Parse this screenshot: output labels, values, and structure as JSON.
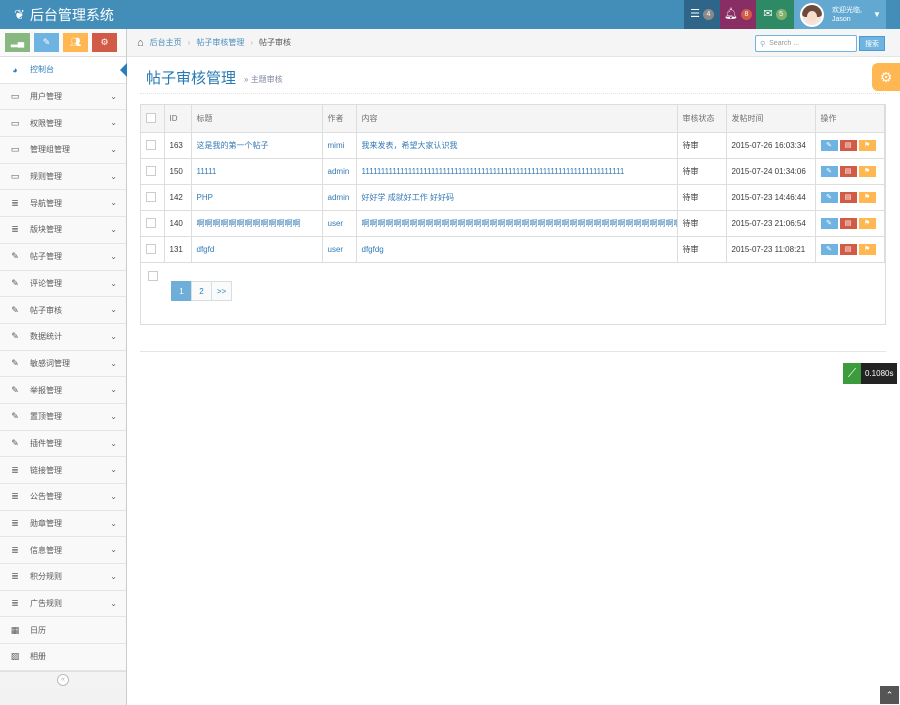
{
  "app": {
    "brand": "后台管理系统",
    "brand_icon": "leaf-icon"
  },
  "navbar": {
    "tasks_badge": "4",
    "notifications_badge": "8",
    "messages_badge": "5",
    "user_greeting": "欢迎光临,",
    "user_name": "Jason"
  },
  "shortcuts": [
    {
      "icon": "signal-icon",
      "color": "#87b87f"
    },
    {
      "icon": "pencil-icon",
      "color": "#6fb3e0"
    },
    {
      "icon": "group-icon",
      "color": "#ffb752"
    },
    {
      "icon": "cogs-icon",
      "color": "#d15b47"
    }
  ],
  "sidebar": {
    "items": [
      {
        "label": "控制台",
        "icon": "dashboard-icon",
        "has_children": false,
        "active": true
      },
      {
        "label": "用户管理",
        "icon": "desktop-icon",
        "has_children": true
      },
      {
        "label": "权限管理",
        "icon": "desktop-icon",
        "has_children": true
      },
      {
        "label": "管理组管理",
        "icon": "desktop-icon",
        "has_children": true
      },
      {
        "label": "规则管理",
        "icon": "desktop-icon",
        "has_children": true
      },
      {
        "label": "导航管理",
        "icon": "list-icon",
        "has_children": true
      },
      {
        "label": "版块管理",
        "icon": "list-icon",
        "has_children": true
      },
      {
        "label": "帖子管理",
        "icon": "edit-icon",
        "has_children": true
      },
      {
        "label": "评论管理",
        "icon": "edit-icon",
        "has_children": true
      },
      {
        "label": "帖子审核",
        "icon": "edit-icon",
        "has_children": true
      },
      {
        "label": "数据统计",
        "icon": "edit-icon",
        "has_children": true
      },
      {
        "label": "敏感词管理",
        "icon": "edit-icon",
        "has_children": true
      },
      {
        "label": "举报管理",
        "icon": "edit-icon",
        "has_children": true
      },
      {
        "label": "置顶管理",
        "icon": "edit-icon",
        "has_children": true
      },
      {
        "label": "插件管理",
        "icon": "edit-icon",
        "has_children": true
      },
      {
        "label": "链接管理",
        "icon": "list-icon",
        "has_children": true
      },
      {
        "label": "公告管理",
        "icon": "list-icon",
        "has_children": true
      },
      {
        "label": "勋章管理",
        "icon": "list-icon",
        "has_children": true
      },
      {
        "label": "信息管理",
        "icon": "list-icon",
        "has_children": true
      },
      {
        "label": "积分规则",
        "icon": "list-icon",
        "has_children": true
      },
      {
        "label": "广告规则",
        "icon": "list-icon",
        "has_children": true
      },
      {
        "label": "日历",
        "icon": "calendar-icon",
        "has_children": false
      },
      {
        "label": "相册",
        "icon": "picture-icon",
        "has_children": false
      }
    ]
  },
  "breadcrumb": {
    "home": "后台主页",
    "section": "帖子审核管理",
    "current": "帖子审核"
  },
  "search": {
    "placeholder": "Search ...",
    "button": "搜索"
  },
  "page": {
    "title": "帖子审核管理",
    "subtitle": "主题审核"
  },
  "table": {
    "columns": [
      "ID",
      "标题",
      "作者",
      "内容",
      "审核状态",
      "发帖时间",
      "操作"
    ],
    "rows": [
      {
        "id": "163",
        "title": "这是我的第一个帖子",
        "author": "mimi",
        "content": "我来发表，希望大家认识我",
        "status": "待审",
        "time": "2015-07-26 16:03:34"
      },
      {
        "id": "150",
        "title": "11111",
        "author": "admin",
        "content": "11111111111111111111111111111111111111111111111111111111111111111111",
        "status": "待审",
        "time": "2015-07-24 01:34:06"
      },
      {
        "id": "142",
        "title": "PHP",
        "author": "admin",
        "content": "好好学 成就好工作 好好码",
        "status": "待审",
        "time": "2015-07-23 14:46:44"
      },
      {
        "id": "140",
        "title": "啊啊啊啊啊啊啊啊啊啊啊啊啊",
        "author": "user",
        "content": "啊啊啊啊啊啊啊啊啊啊啊啊啊啊啊啊啊啊啊啊啊啊啊啊啊啊啊啊啊啊啊啊啊啊啊啊啊啊啊啊",
        "status": "待审",
        "time": "2015-07-23 21:06:54"
      },
      {
        "id": "131",
        "title": "dfgfd",
        "author": "user",
        "content": "dfgfdg",
        "status": "待审",
        "time": "2015-07-23 11:08:21"
      }
    ]
  },
  "pagination": {
    "pages": [
      "1",
      "2"
    ],
    "next": ">>",
    "current": "1"
  },
  "timer": {
    "value": "0.1080s"
  }
}
